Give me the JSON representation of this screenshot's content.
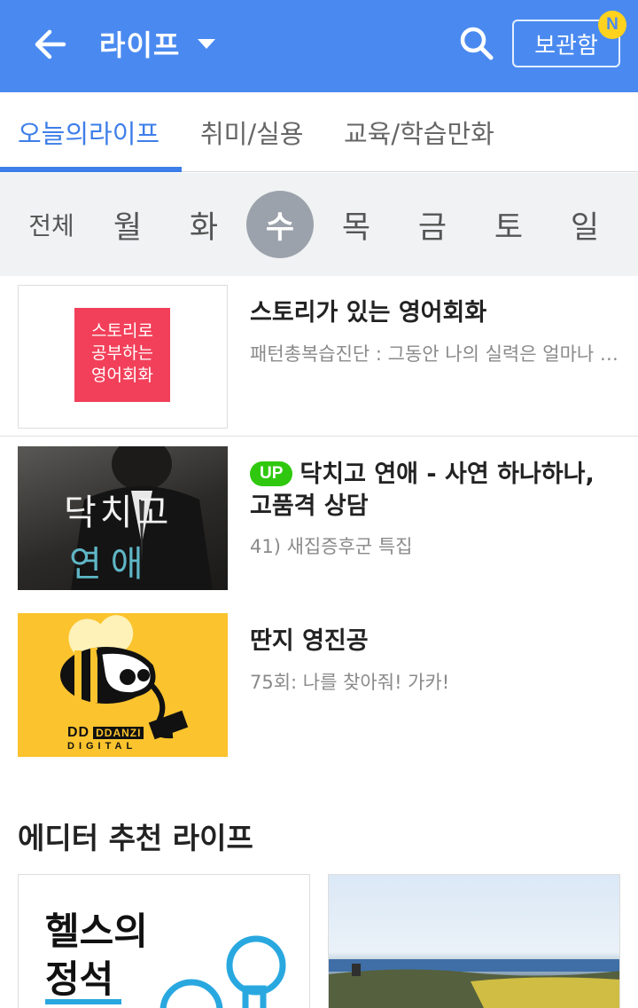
{
  "header": {
    "title": "라이프",
    "storage_label": "보관함",
    "new_badge": "N",
    "back_icon": "arrow-left-icon",
    "search_icon": "search-icon",
    "color": "#4a8af0"
  },
  "tabs": [
    {
      "label": "오늘의라이프",
      "active": true
    },
    {
      "label": "취미/실용",
      "active": false
    },
    {
      "label": "교육/학습만화",
      "active": false
    }
  ],
  "days": [
    {
      "label": "전체",
      "active": false
    },
    {
      "label": "월",
      "active": false
    },
    {
      "label": "화",
      "active": false
    },
    {
      "label": "수",
      "active": true
    },
    {
      "label": "목",
      "active": false
    },
    {
      "label": "금",
      "active": false
    },
    {
      "label": "토",
      "active": false
    },
    {
      "label": "일",
      "active": false
    }
  ],
  "items": [
    {
      "title": "스토리가 있는 영어회화",
      "subtitle": "패턴총복습진단 : 그동안 나의 실력은 얼마나 늘었을까",
      "thumb_text": [
        "스토리로",
        "공부하는",
        "영어회화"
      ]
    },
    {
      "badge": "UP",
      "title_line1": "닥치고 연애 - 사연 하나하나,",
      "title_line2": "고품격 상담",
      "subtitle": "41) 새집증후군 특집",
      "thumb_text": [
        "닥치고",
        "연애"
      ]
    },
    {
      "title": "딴지 영진공",
      "subtitle": "75회: 나를 찾아줘! 가카!",
      "thumb_text": [
        "DDANZI",
        "DIGITAL"
      ]
    }
  ],
  "editor": {
    "section_title": "에디터 추천 라이프",
    "card1_text": [
      "헬스의",
      "정석"
    ]
  }
}
